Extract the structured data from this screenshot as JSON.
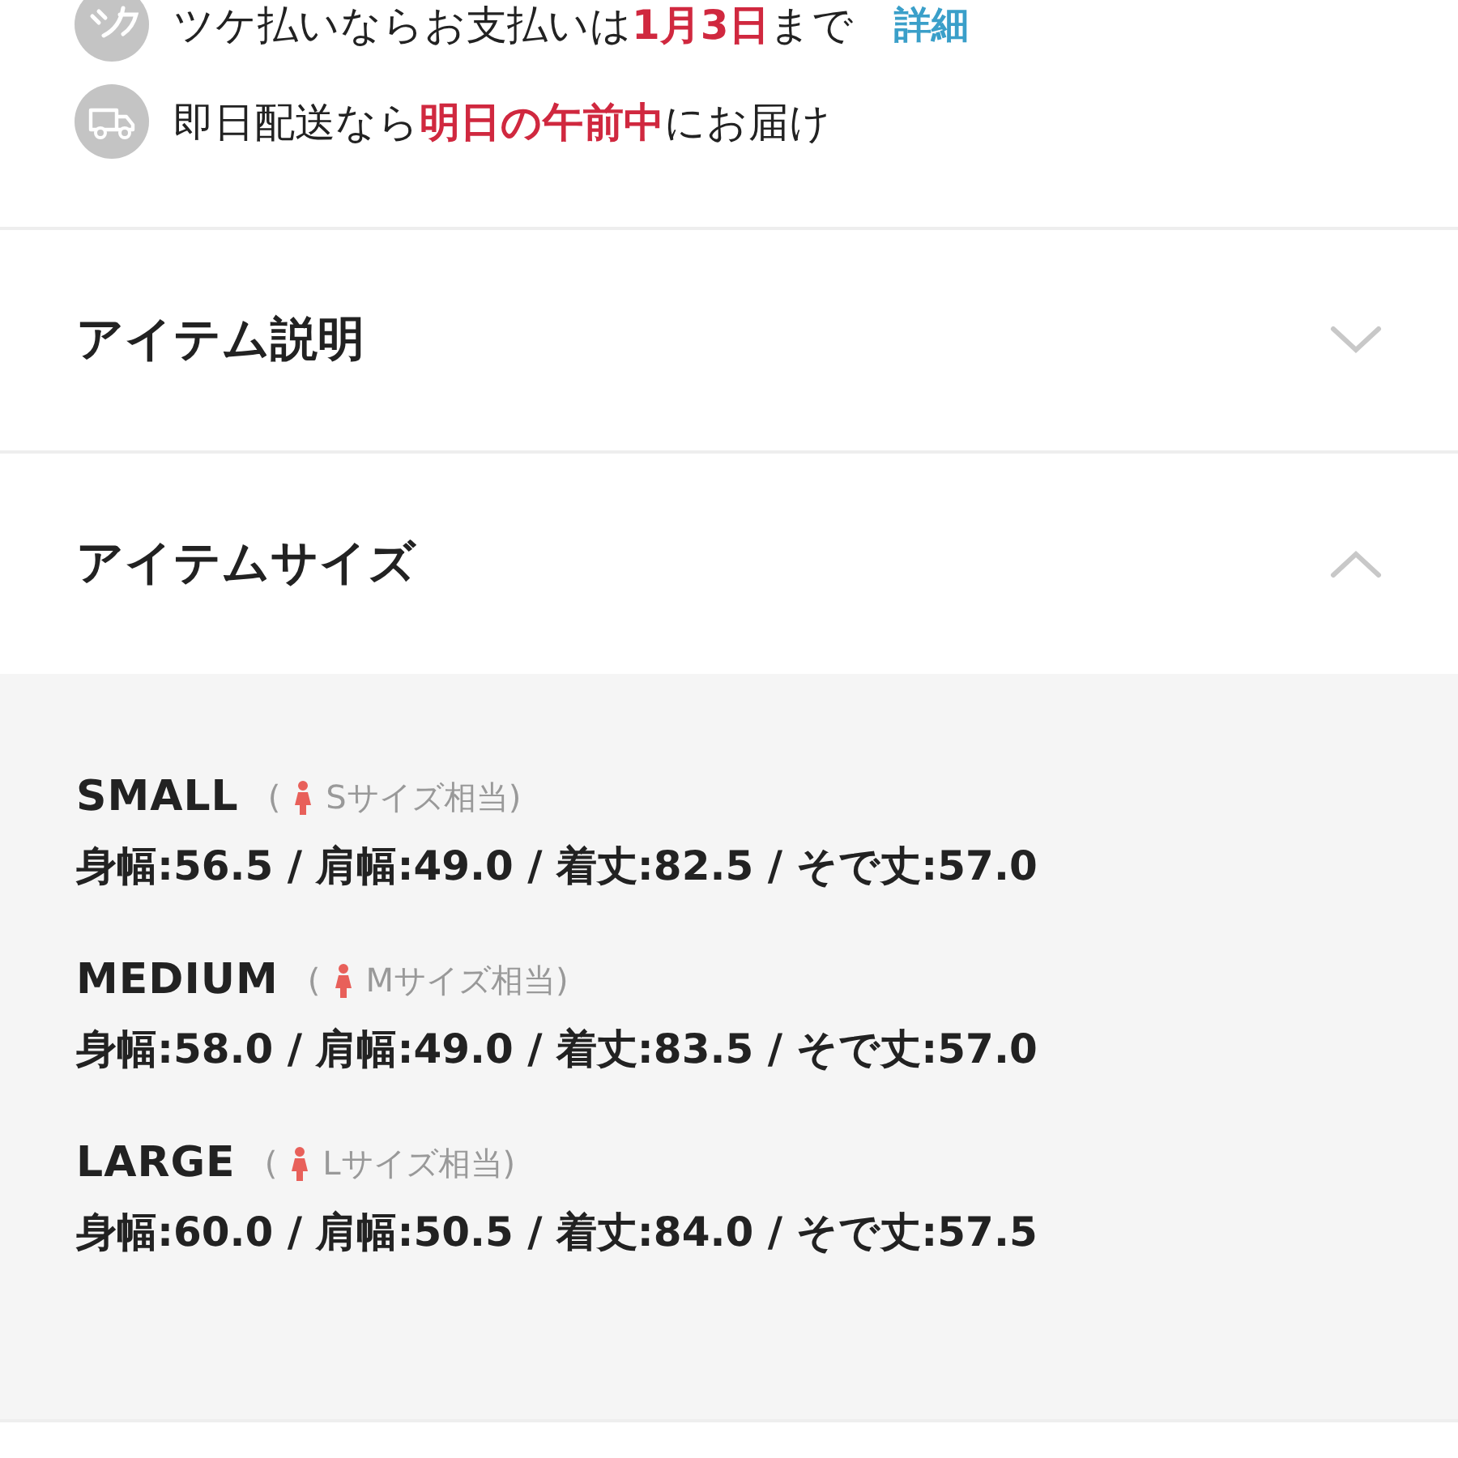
{
  "info_rows": [
    {
      "kind": "tsuke",
      "parts": [
        {
          "text": "ツケ払いならお支払いは",
          "emphasis": false
        },
        {
          "text": "1月3日",
          "emphasis": true
        },
        {
          "text": "まで",
          "emphasis": false
        }
      ],
      "link": "詳細"
    },
    {
      "kind": "truck",
      "parts": [
        {
          "text": "即日配送なら",
          "emphasis": false
        },
        {
          "text": "明日の午前中",
          "emphasis": true
        },
        {
          "text": "にお届け",
          "emphasis": false
        }
      ]
    }
  ],
  "accordions": [
    {
      "title": "アイテム説明",
      "expanded": false
    },
    {
      "title": "アイテムサイズ",
      "expanded": true,
      "sizes": [
        {
          "name": "SMALL",
          "paren": "(",
          "note": "Sサイズ相当)",
          "measures": "身幅:56.5 / 肩幅:49.0 / 着丈:82.5 / そで丈:57.0"
        },
        {
          "name": "MEDIUM",
          "paren": "(",
          "note": "Mサイズ相当)",
          "measures": "身幅:58.0 / 肩幅:49.0 / 着丈:83.5 / そで丈:57.0"
        },
        {
          "name": "LARGE",
          "paren": "(",
          "note": "Lサイズ相当)",
          "measures": "身幅:60.0 / 肩幅:50.5 / 着丈:84.0 / そで丈:57.5"
        }
      ]
    }
  ]
}
